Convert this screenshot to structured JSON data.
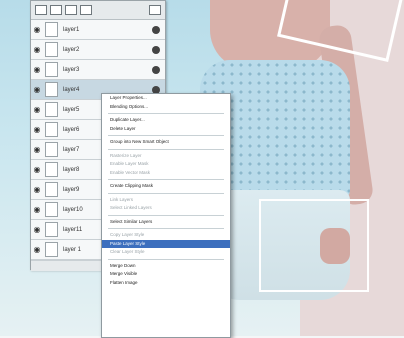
{
  "layers_panel": {
    "rows": [
      {
        "name": "layer1"
      },
      {
        "name": "layer2"
      },
      {
        "name": "layer3"
      },
      {
        "name": "layer4"
      },
      {
        "name": "layer5"
      },
      {
        "name": "layer6"
      },
      {
        "name": "layer7"
      },
      {
        "name": "layer8"
      },
      {
        "name": "layer9"
      },
      {
        "name": "layer10"
      },
      {
        "name": "layer11"
      },
      {
        "name": "layer 1"
      }
    ]
  },
  "context_menu": {
    "items": [
      {
        "label": "Layer Properties...",
        "enabled": true
      },
      {
        "label": "Blending Options...",
        "enabled": true
      },
      {
        "label": "Duplicate Layer...",
        "enabled": true
      },
      {
        "label": "Delete Layer",
        "enabled": true
      },
      {
        "label": "Group into New Smart Object",
        "enabled": true
      },
      {
        "label": "Rasterize Layer",
        "enabled": false
      },
      {
        "label": "Enable Layer Mask",
        "enabled": false
      },
      {
        "label": "Enable Vector Mask",
        "enabled": false
      },
      {
        "label": "Create Clipping Mask",
        "enabled": true
      },
      {
        "label": "Link Layers",
        "enabled": false
      },
      {
        "label": "Select Linked Layers",
        "enabled": false
      },
      {
        "label": "Select Similar Layers",
        "enabled": true
      },
      {
        "label": "Copy Layer Style",
        "enabled": false
      },
      {
        "label": "Paste Layer Style",
        "enabled": true,
        "selected": true
      },
      {
        "label": "Clear Layer Style",
        "enabled": false
      },
      {
        "label": "Merge Down",
        "enabled": true
      },
      {
        "label": "Merge Visible",
        "enabled": true
      },
      {
        "label": "Flatten Image",
        "enabled": true
      }
    ]
  }
}
